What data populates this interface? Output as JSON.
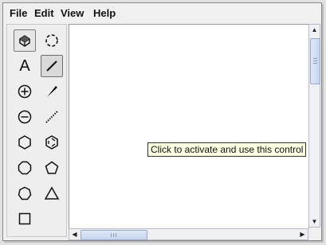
{
  "menubar": {
    "items": [
      "File",
      "Edit",
      "View",
      "Help"
    ]
  },
  "toolbox": {
    "tools": [
      {
        "name": "select-tool",
        "icon": "eraser-select-icon"
      },
      {
        "name": "lasso-tool",
        "icon": "lasso-icon"
      },
      {
        "name": "text-tool",
        "icon": "text-icon",
        "glyph": "A"
      },
      {
        "name": "line-tool",
        "icon": "line-icon"
      },
      {
        "name": "zoom-in-tool",
        "icon": "plus-circle-icon"
      },
      {
        "name": "bond-tool",
        "icon": "wedge-bond-icon"
      },
      {
        "name": "zoom-out-tool",
        "icon": "minus-circle-icon"
      },
      {
        "name": "dashed-bond-tool",
        "icon": "hashed-bond-icon"
      },
      {
        "name": "hexagon-tool",
        "icon": "hexagon-icon"
      },
      {
        "name": "benzene-tool",
        "icon": "benzene-icon"
      },
      {
        "name": "octagon-tool",
        "icon": "octagon-icon"
      },
      {
        "name": "pentagon-tool",
        "icon": "pentagon-icon"
      },
      {
        "name": "heptagon-tool",
        "icon": "heptagon-icon"
      },
      {
        "name": "triangle-tool",
        "icon": "triangle-icon"
      },
      {
        "name": "square-tool",
        "icon": "square-icon"
      }
    ]
  },
  "tooltip": {
    "text": "Click to activate and use this control"
  },
  "colors": {
    "tooltip_bg": "#ffffe1",
    "scrollbar_thumb": "#c7d6ee",
    "selected_tool_bg": "#e6e6e6"
  }
}
